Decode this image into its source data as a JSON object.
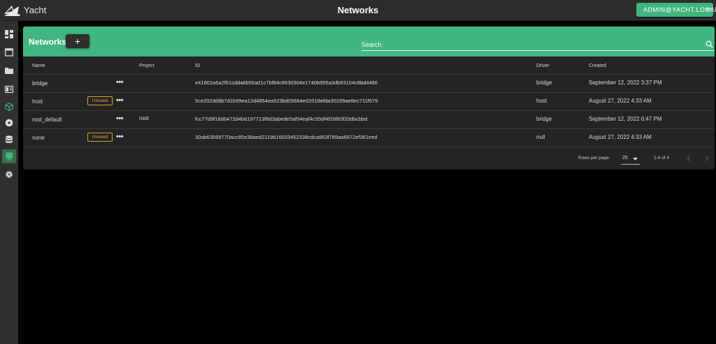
{
  "app": {
    "name": "Yacht",
    "page_title": "Networks",
    "user": "ADMIN@YACHT.LOCAL"
  },
  "colors": {
    "accent": "#41b67f",
    "badge": "#e0a32e",
    "surface": "#242424"
  },
  "sidebar": {
    "items": [
      {
        "icon": "dashboard-icon"
      },
      {
        "icon": "window-icon"
      },
      {
        "icon": "folder-icon"
      },
      {
        "icon": "template-icon"
      },
      {
        "icon": "cube-icon"
      },
      {
        "icon": "disc-icon"
      },
      {
        "icon": "database-icon"
      },
      {
        "icon": "network-icon",
        "active": true
      },
      {
        "icon": "settings-icon"
      }
    ]
  },
  "networks": {
    "title": "Networks",
    "add_label": "+",
    "search_label": "Search",
    "columns": {
      "name": "Name",
      "project": "Project",
      "id": "ID",
      "driver": "Driver",
      "created": "Created"
    },
    "rows": [
      {
        "name": "bridge",
        "badge": "",
        "project": "",
        "id": "e41802a6a2f61cdda6b56a01c7bf84c8630304e1740b955a3db93104c8bd4466",
        "driver": "bridge",
        "created": "September 12, 2022 3:37 PM"
      },
      {
        "name": "host",
        "badge": "Unused",
        "project": "",
        "id": "5ce202dd9b7d1b99ea12d4854ea523bd05664e02018efda30199ae8ec711f675",
        "driver": "host",
        "created": "August 27, 2022 4:33 AM"
      },
      {
        "name": "root_default",
        "badge": "",
        "project": "root",
        "id": "fcc77d9f18d6472d4b6197713f8d3abede5af54eaf4c55df4f26f83f20dbcbbd",
        "driver": "bridge",
        "created": "September 12, 2022 6:47 PM"
      },
      {
        "name": "none",
        "badge": "Unused",
        "project": "",
        "id": "30ab63569770acc85e38aed2119b16033452338cdca863f789aa6672ef361eed",
        "driver": "null",
        "created": "August 27, 2022 4:33 AM"
      }
    ],
    "row_menu_label": "•••",
    "pagination": {
      "rows_per_page_label": "Rows per page:",
      "rows_per_page": "25",
      "range": "1-4 of 4"
    }
  }
}
